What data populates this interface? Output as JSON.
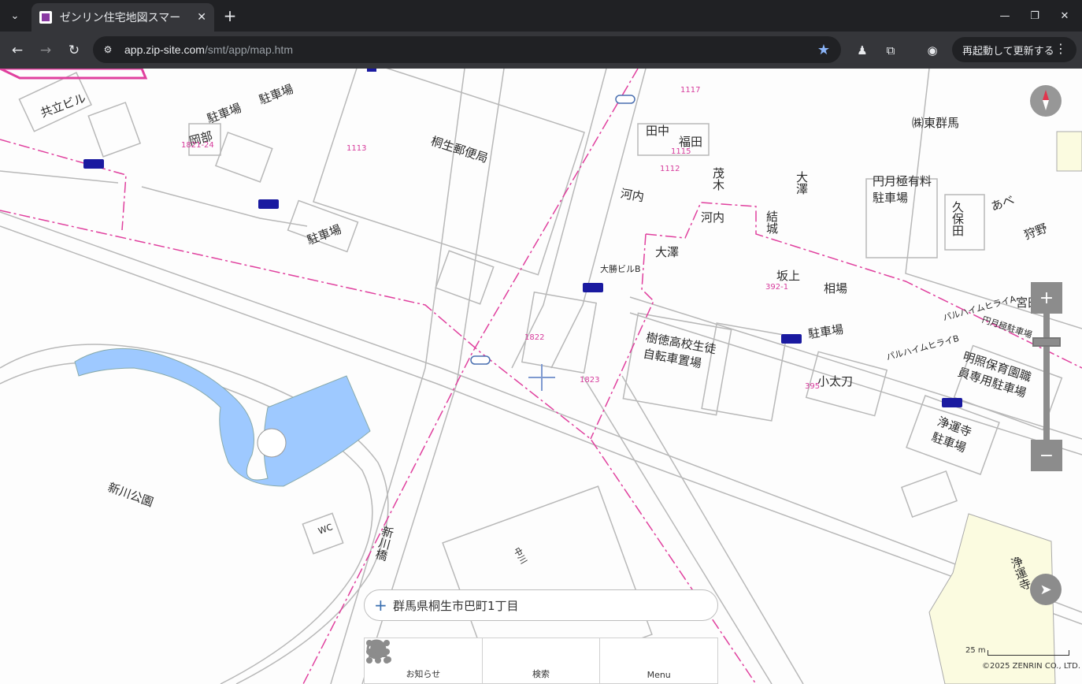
{
  "browser": {
    "tab_title": "ゼンリン住宅地図スマー",
    "url_host": "app.zip-site.com",
    "url_path": "/smt/app/map.htm",
    "restart_label": "再起動して更新する"
  },
  "map": {
    "labels": {
      "kiryu_post": "桐生郵便局",
      "parking_1": "駐車場",
      "parking_2": "駐車場",
      "parking_3": "駐車場",
      "parking_4": "駐車場",
      "kyoritsu": "共立ビル",
      "okabe": "岡部",
      "tanaka": "田中",
      "fukuda": "福田",
      "kawachi_1": "河内",
      "kawachi_2": "河内",
      "shigeki": "茂木",
      "osawa_1": "大澤",
      "osawa_2": "大澤",
      "yuki": "結城",
      "sakagami": "坂上",
      "aiba": "相場",
      "tobu_gunma": "㈱東群馬",
      "engetsu_parking": "円月極有料駐車場",
      "kubota": "久保田",
      "abe": "あべ",
      "kariya": "狩野",
      "jukutoku": "樹徳高校生徒自転車置場",
      "kotachi": "小太刀",
      "shinkawa_park": "新川公園",
      "wc": "WC",
      "shinkawa_bridge": "新川橋",
      "meisho": "明照保育園職員専用駐車場",
      "jounji_parking": "浄運寺駐車場",
      "jounji": "浄運寺",
      "engetsu_2": "円月極駐車場",
      "palheim_1": "パルハイムヒライA",
      "palheim_2": "パルハイムヒライB",
      "daikatsu": "大勝ビルB",
      "miya": "宮田",
      "nakagawa": "中川"
    },
    "numbers": {
      "n1113": "1113",
      "n1112": "1112",
      "n1115": "1115",
      "n1117": "1117",
      "n1822": "1822",
      "n1823": "1823",
      "n395": "395",
      "n392": "392-1",
      "n1821": "1821-24"
    },
    "address": "群馬県桐生市巴町1丁目",
    "scale_label": "25 m",
    "copyright": "©2025 ZENRIN CO., LTD."
  },
  "bottom_nav": {
    "notice": "お知らせ",
    "search": "検索",
    "menu": "Menu"
  },
  "colors": {
    "pond": "#9ec9ff",
    "boundary": "#e0409e",
    "control": "#8c8c8c",
    "parking_sign": "#1a1aa0"
  }
}
